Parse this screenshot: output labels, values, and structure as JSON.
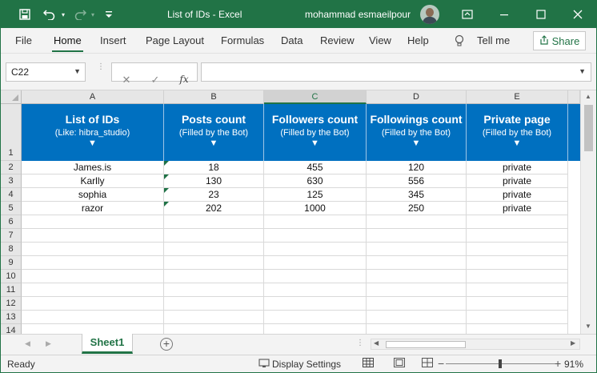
{
  "titlebar": {
    "title": "List of IDs  -  Excel",
    "user": "mohammad esmaeilpour"
  },
  "ribbon": {
    "tabs": [
      "File",
      "Home",
      "Insert",
      "Page Layout",
      "Formulas",
      "Data",
      "Review",
      "View",
      "Help"
    ],
    "active_tab": "Home",
    "tell_me": "Tell me",
    "share": "Share"
  },
  "formula_bar": {
    "name_box": "C22",
    "cancel_symbol": "✕",
    "enter_symbol": "✓",
    "fx_symbol": "fx",
    "formula": ""
  },
  "grid": {
    "columns": [
      "A",
      "B",
      "C",
      "D",
      "E"
    ],
    "selected_column": "C",
    "row_numbers": [
      "1",
      "2",
      "3",
      "4",
      "5",
      "6",
      "7",
      "8",
      "9",
      "10",
      "11",
      "12",
      "13",
      "14"
    ],
    "header_cells": [
      {
        "title": "List of IDs",
        "subtitle": "(Like: hibra_studio)",
        "arrow": "▼"
      },
      {
        "title": "Posts count",
        "subtitle": "(Filled by the Bot)",
        "arrow": "▼"
      },
      {
        "title": "Followers count",
        "subtitle": "(Filled by the Bot)",
        "arrow": "▼"
      },
      {
        "title": "Followings count",
        "subtitle": "(Filled by the Bot)",
        "arrow": "▼"
      },
      {
        "title": "Private page",
        "subtitle": "(Filled by the Bot)",
        "arrow": "▼"
      }
    ],
    "rows": [
      [
        "James.is",
        "18",
        "455",
        "120",
        "private"
      ],
      [
        "Karlly",
        "130",
        "630",
        "556",
        "private"
      ],
      [
        "sophia",
        "23",
        "125",
        "345",
        "private"
      ],
      [
        "razor",
        "202",
        "1000",
        "250",
        "private"
      ]
    ],
    "header_fill_color": "#0070c0",
    "accent_color": "#217346"
  },
  "sheets": {
    "tabs": [
      "Sheet1"
    ],
    "active": "Sheet1",
    "add_symbol": "+"
  },
  "statusbar": {
    "status": "Ready",
    "display_settings": "Display Settings",
    "zoom_minus": "−",
    "zoom_plus": "+",
    "zoom": "91%"
  }
}
